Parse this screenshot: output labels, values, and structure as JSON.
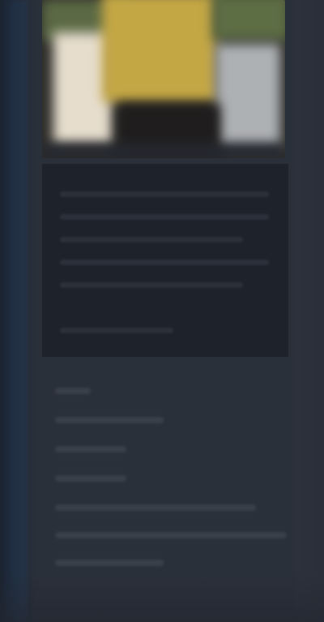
{
  "screen": {
    "theme": "dark",
    "colors": {
      "background": "#2b303a",
      "panel": "#1e222b",
      "accent_left": "#213044",
      "image_yellow": "#c4a745",
      "image_cream": "#e6ddcd",
      "image_green": "#5b6a45"
    }
  },
  "hero_image": {
    "alt": "",
    "visible_text": ""
  },
  "article": {
    "text": ""
  },
  "metadata": {
    "text": ""
  }
}
